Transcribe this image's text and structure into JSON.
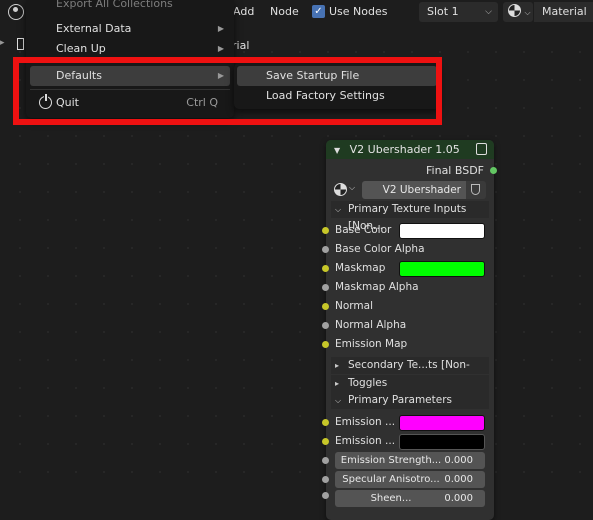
{
  "header": {
    "add": "Add",
    "node": "Node",
    "use_nodes_label": "Use Nodes",
    "use_nodes_checked": "✓",
    "slot": "Slot 1",
    "material": "Material",
    "behind_menu_text": "rial"
  },
  "main_menu": {
    "items": [
      {
        "label": "Export All Collections"
      },
      {
        "label": "External Data"
      },
      {
        "label": "Clean Up"
      },
      {
        "label": "Defaults"
      },
      {
        "label": "Quit",
        "shortcut": "Ctrl Q"
      }
    ]
  },
  "defaults_submenu": {
    "items": [
      {
        "label": "Save Startup File"
      },
      {
        "label": "Load Factory Settings"
      }
    ]
  },
  "node": {
    "title": "V2 Ubershader 1.05",
    "output": "Final BSDF",
    "group_name": "V2 Ubershader 1.05",
    "panels": {
      "primary_textures": "Primary Texture Inputs [Non...",
      "secondary_textures": "Secondary Te...ts [Non-color]",
      "toggles": "Toggles",
      "primary_parameters": "Primary Parameters"
    },
    "inputs": [
      {
        "label": "Base Color",
        "swatch": "#ffffff"
      },
      {
        "label": "Base Color Alpha"
      },
      {
        "label": "Maskmap",
        "swatch": "#00ff00"
      },
      {
        "label": "Maskmap Alpha"
      },
      {
        "label": "Normal"
      },
      {
        "label": "Normal Alpha"
      },
      {
        "label": "Emission Map"
      }
    ],
    "params": [
      {
        "label": "Emission ...",
        "swatch": "#ff00ff"
      },
      {
        "label": "Emission ...",
        "swatch": "#000000"
      }
    ],
    "numeric": [
      {
        "label": "Emission Strength...",
        "value": "0.000"
      },
      {
        "label": "Specular Anisotro...",
        "value": "0.000"
      },
      {
        "label": "Sheen...",
        "value": "0.000"
      }
    ]
  }
}
